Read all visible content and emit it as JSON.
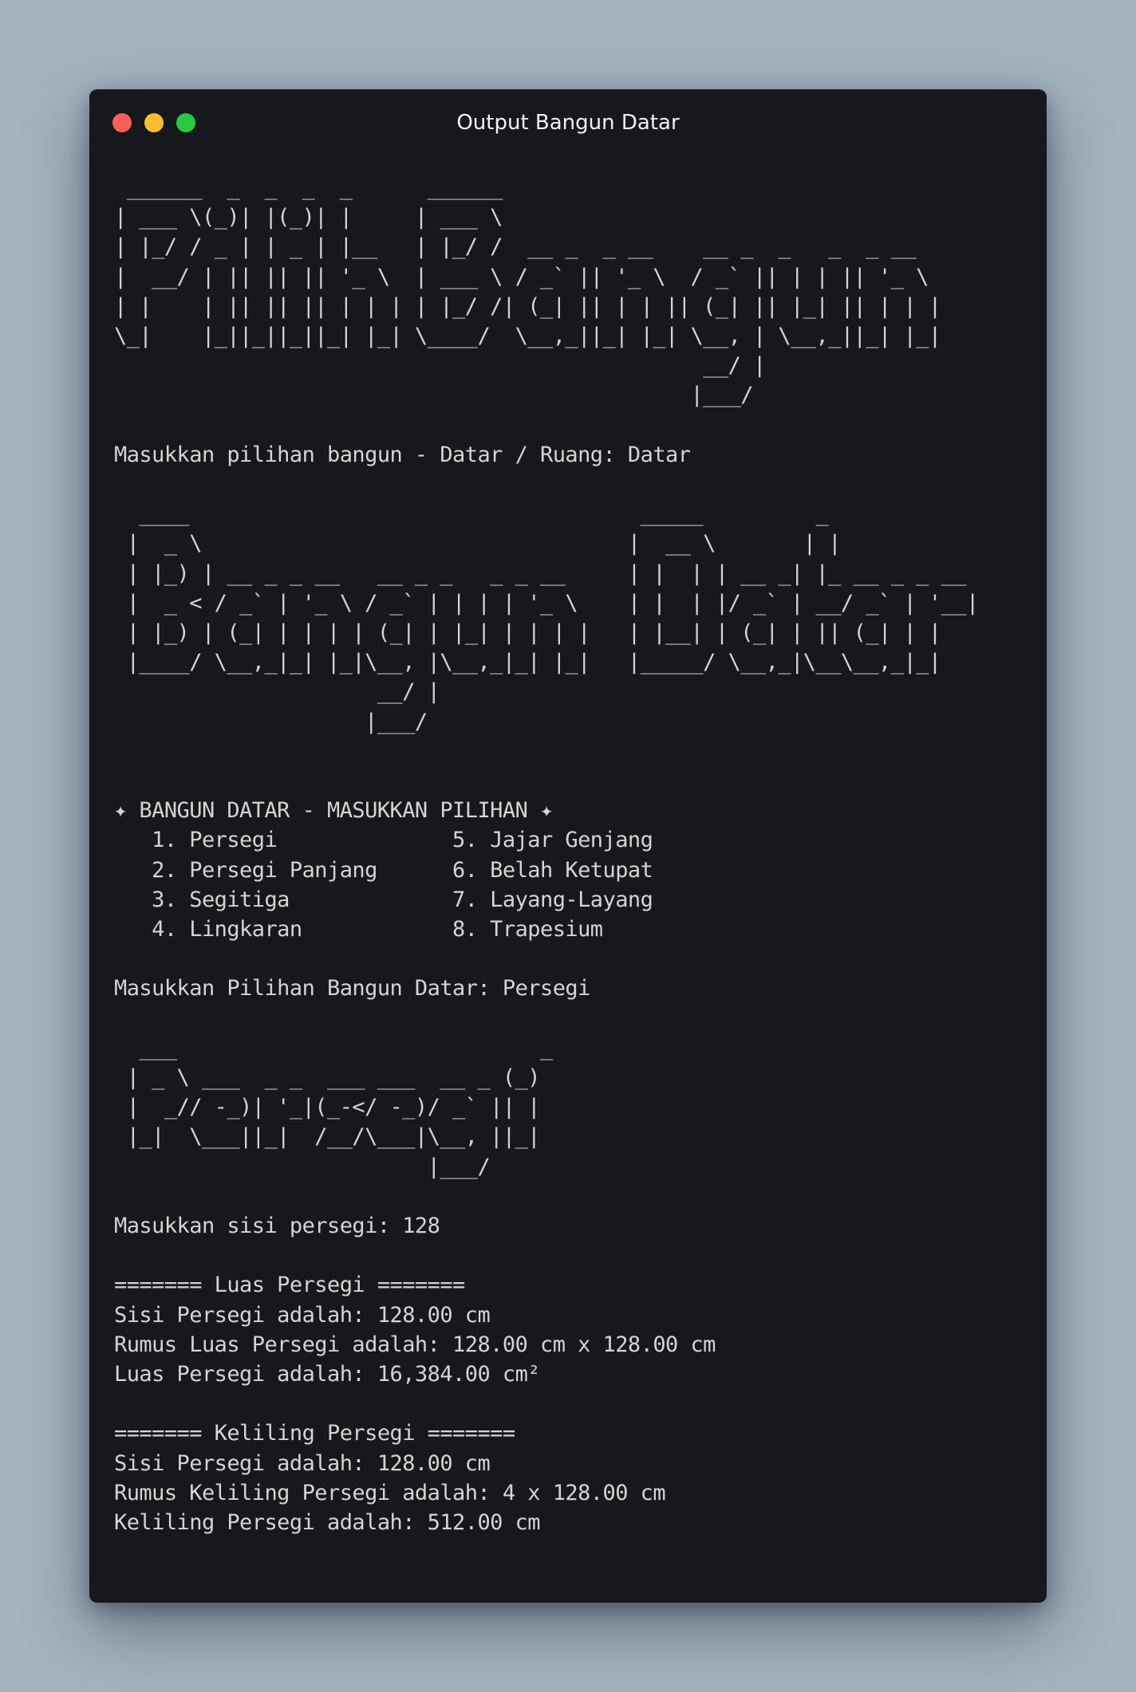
{
  "window": {
    "title": "Output Bangun Datar"
  },
  "terminal": {
    "lines": [
      " ______  _  _  _  _      ______",
      "| ___ \\(_)| |(_)| |     | ___ \\",
      "| |_/ / _ | | _ | |__   | |_/ /  __ _  _ __    __ _  _   _  _ __",
      "|  __/ | || || || '_ \\  | ___ \\ / _` || '_ \\  / _` || | | || '_ \\",
      "| |    | || || || | | | | |_/ /| (_| || | | || (_| || |_| || | | |",
      "\\_|    |_||_||_||_| |_| \\____/  \\__,_||_| |_| \\__, | \\__,_||_| |_|",
      "                                               __/ |",
      "                                              |___/",
      "",
      "Masukkan pilihan bangun - Datar / Ruang: Datar",
      "",
      "  ____                                    _____         _",
      " |  _ \\                                  |  __ \\       | |",
      " | |_) | __ _ _ __   __ _ _   _ _ __     | |  | | __ _| |_ __ _ _ __",
      " |  _ < / _` | '_ \\ / _` | | | | '_ \\    | |  | |/ _` | __/ _` | '__|",
      " | |_) | (_| | | | | (_| | |_| | | | |   | |__| | (_| | || (_| | |",
      " |____/ \\__,_|_| |_|\\__, |\\__,_|_| |_|   |_____/ \\__,_|\\__\\__,_|_|",
      "                     __/ |",
      "                    |___/",
      "",
      "",
      "✦ BANGUN DATAR - MASUKKAN PILIHAN ✦",
      "   1. Persegi              5. Jajar Genjang",
      "   2. Persegi Panjang      6. Belah Ketupat",
      "   3. Segitiga             7. Layang-Layang",
      "   4. Lingkaran            8. Trapesium",
      "",
      "Masukkan Pilihan Bangun Datar: Persegi",
      "",
      "  ___                             _",
      " | _ \\ ___  _ _  ___ ___  __ _ (_)",
      " |  _// -_)| '_|(_-</ -_)/ _` || |",
      " |_|  \\___||_|  /__/\\___|\\__, ||_|",
      "                         |___/",
      "",
      "Masukkan sisi persegi: 128",
      "",
      "======= Luas Persegi =======",
      "Sisi Persegi adalah: 128.00 cm",
      "Rumus Luas Persegi adalah: 128.00 cm x 128.00 cm",
      "Luas Persegi adalah: 16,384.00 cm²",
      "",
      "======= Keliling Persegi =======",
      "Sisi Persegi adalah: 128.00 cm",
      "Rumus Keliling Persegi adalah: 4 x 128.00 cm",
      "Keliling Persegi adalah: 512.00 cm"
    ]
  }
}
